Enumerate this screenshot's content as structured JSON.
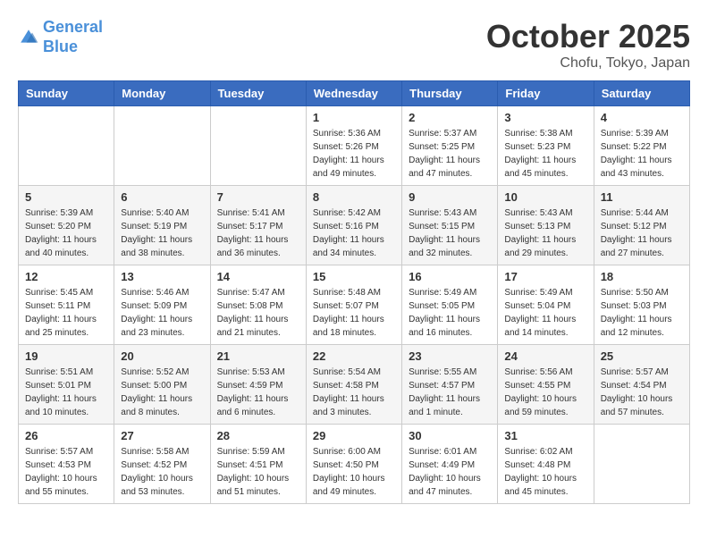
{
  "header": {
    "logo_line1": "General",
    "logo_line2": "Blue",
    "month": "October 2025",
    "location": "Chofu, Tokyo, Japan"
  },
  "weekdays": [
    "Sunday",
    "Monday",
    "Tuesday",
    "Wednesday",
    "Thursday",
    "Friday",
    "Saturday"
  ],
  "weeks": [
    [
      {
        "day": "",
        "sunrise": "",
        "sunset": "",
        "daylight": ""
      },
      {
        "day": "",
        "sunrise": "",
        "sunset": "",
        "daylight": ""
      },
      {
        "day": "",
        "sunrise": "",
        "sunset": "",
        "daylight": ""
      },
      {
        "day": "1",
        "sunrise": "Sunrise: 5:36 AM",
        "sunset": "Sunset: 5:26 PM",
        "daylight": "Daylight: 11 hours and 49 minutes."
      },
      {
        "day": "2",
        "sunrise": "Sunrise: 5:37 AM",
        "sunset": "Sunset: 5:25 PM",
        "daylight": "Daylight: 11 hours and 47 minutes."
      },
      {
        "day": "3",
        "sunrise": "Sunrise: 5:38 AM",
        "sunset": "Sunset: 5:23 PM",
        "daylight": "Daylight: 11 hours and 45 minutes."
      },
      {
        "day": "4",
        "sunrise": "Sunrise: 5:39 AM",
        "sunset": "Sunset: 5:22 PM",
        "daylight": "Daylight: 11 hours and 43 minutes."
      }
    ],
    [
      {
        "day": "5",
        "sunrise": "Sunrise: 5:39 AM",
        "sunset": "Sunset: 5:20 PM",
        "daylight": "Daylight: 11 hours and 40 minutes."
      },
      {
        "day": "6",
        "sunrise": "Sunrise: 5:40 AM",
        "sunset": "Sunset: 5:19 PM",
        "daylight": "Daylight: 11 hours and 38 minutes."
      },
      {
        "day": "7",
        "sunrise": "Sunrise: 5:41 AM",
        "sunset": "Sunset: 5:17 PM",
        "daylight": "Daylight: 11 hours and 36 minutes."
      },
      {
        "day": "8",
        "sunrise": "Sunrise: 5:42 AM",
        "sunset": "Sunset: 5:16 PM",
        "daylight": "Daylight: 11 hours and 34 minutes."
      },
      {
        "day": "9",
        "sunrise": "Sunrise: 5:43 AM",
        "sunset": "Sunset: 5:15 PM",
        "daylight": "Daylight: 11 hours and 32 minutes."
      },
      {
        "day": "10",
        "sunrise": "Sunrise: 5:43 AM",
        "sunset": "Sunset: 5:13 PM",
        "daylight": "Daylight: 11 hours and 29 minutes."
      },
      {
        "day": "11",
        "sunrise": "Sunrise: 5:44 AM",
        "sunset": "Sunset: 5:12 PM",
        "daylight": "Daylight: 11 hours and 27 minutes."
      }
    ],
    [
      {
        "day": "12",
        "sunrise": "Sunrise: 5:45 AM",
        "sunset": "Sunset: 5:11 PM",
        "daylight": "Daylight: 11 hours and 25 minutes."
      },
      {
        "day": "13",
        "sunrise": "Sunrise: 5:46 AM",
        "sunset": "Sunset: 5:09 PM",
        "daylight": "Daylight: 11 hours and 23 minutes."
      },
      {
        "day": "14",
        "sunrise": "Sunrise: 5:47 AM",
        "sunset": "Sunset: 5:08 PM",
        "daylight": "Daylight: 11 hours and 21 minutes."
      },
      {
        "day": "15",
        "sunrise": "Sunrise: 5:48 AM",
        "sunset": "Sunset: 5:07 PM",
        "daylight": "Daylight: 11 hours and 18 minutes."
      },
      {
        "day": "16",
        "sunrise": "Sunrise: 5:49 AM",
        "sunset": "Sunset: 5:05 PM",
        "daylight": "Daylight: 11 hours and 16 minutes."
      },
      {
        "day": "17",
        "sunrise": "Sunrise: 5:49 AM",
        "sunset": "Sunset: 5:04 PM",
        "daylight": "Daylight: 11 hours and 14 minutes."
      },
      {
        "day": "18",
        "sunrise": "Sunrise: 5:50 AM",
        "sunset": "Sunset: 5:03 PM",
        "daylight": "Daylight: 11 hours and 12 minutes."
      }
    ],
    [
      {
        "day": "19",
        "sunrise": "Sunrise: 5:51 AM",
        "sunset": "Sunset: 5:01 PM",
        "daylight": "Daylight: 11 hours and 10 minutes."
      },
      {
        "day": "20",
        "sunrise": "Sunrise: 5:52 AM",
        "sunset": "Sunset: 5:00 PM",
        "daylight": "Daylight: 11 hours and 8 minutes."
      },
      {
        "day": "21",
        "sunrise": "Sunrise: 5:53 AM",
        "sunset": "Sunset: 4:59 PM",
        "daylight": "Daylight: 11 hours and 6 minutes."
      },
      {
        "day": "22",
        "sunrise": "Sunrise: 5:54 AM",
        "sunset": "Sunset: 4:58 PM",
        "daylight": "Daylight: 11 hours and 3 minutes."
      },
      {
        "day": "23",
        "sunrise": "Sunrise: 5:55 AM",
        "sunset": "Sunset: 4:57 PM",
        "daylight": "Daylight: 11 hours and 1 minute."
      },
      {
        "day": "24",
        "sunrise": "Sunrise: 5:56 AM",
        "sunset": "Sunset: 4:55 PM",
        "daylight": "Daylight: 10 hours and 59 minutes."
      },
      {
        "day": "25",
        "sunrise": "Sunrise: 5:57 AM",
        "sunset": "Sunset: 4:54 PM",
        "daylight": "Daylight: 10 hours and 57 minutes."
      }
    ],
    [
      {
        "day": "26",
        "sunrise": "Sunrise: 5:57 AM",
        "sunset": "Sunset: 4:53 PM",
        "daylight": "Daylight: 10 hours and 55 minutes."
      },
      {
        "day": "27",
        "sunrise": "Sunrise: 5:58 AM",
        "sunset": "Sunset: 4:52 PM",
        "daylight": "Daylight: 10 hours and 53 minutes."
      },
      {
        "day": "28",
        "sunrise": "Sunrise: 5:59 AM",
        "sunset": "Sunset: 4:51 PM",
        "daylight": "Daylight: 10 hours and 51 minutes."
      },
      {
        "day": "29",
        "sunrise": "Sunrise: 6:00 AM",
        "sunset": "Sunset: 4:50 PM",
        "daylight": "Daylight: 10 hours and 49 minutes."
      },
      {
        "day": "30",
        "sunrise": "Sunrise: 6:01 AM",
        "sunset": "Sunset: 4:49 PM",
        "daylight": "Daylight: 10 hours and 47 minutes."
      },
      {
        "day": "31",
        "sunrise": "Sunrise: 6:02 AM",
        "sunset": "Sunset: 4:48 PM",
        "daylight": "Daylight: 10 hours and 45 minutes."
      },
      {
        "day": "",
        "sunrise": "",
        "sunset": "",
        "daylight": ""
      }
    ]
  ]
}
